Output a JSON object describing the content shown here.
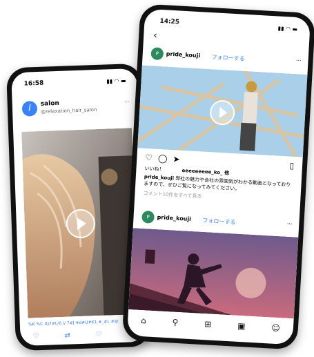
{
  "left_phone": {
    "time": "16:58",
    "avatar_letter": "l",
    "account_name": "salon",
    "account_handle": "@relaxation_hair_salon",
    "caption_line": "%K %C #J7#L/6 // 7#J #d#U#K1 #_#L #@"
  },
  "right_phone": {
    "time": "14:25",
    "post1": {
      "username": "pride_kouji",
      "follow": "フォローする"
    },
    "likes_label": "いいね！",
    "liked_by": "eeeeeeeee_ko_ 他",
    "caption_user": "pride_kouji",
    "caption_text": "弊社の魅力や会社の雰囲気がわかる動画となっておりますので、ぜひご覧になってみてください。",
    "comments_link": "コメント10件をすべて見る",
    "post2": {
      "username": "pride_kouji",
      "follow": "フォローする"
    }
  },
  "colors": {
    "accent_blue": "#3a82f7",
    "sky": "#9ec7e0",
    "sunset_top": "#6e5a8c",
    "sunset_bottom": "#c96a7d"
  }
}
